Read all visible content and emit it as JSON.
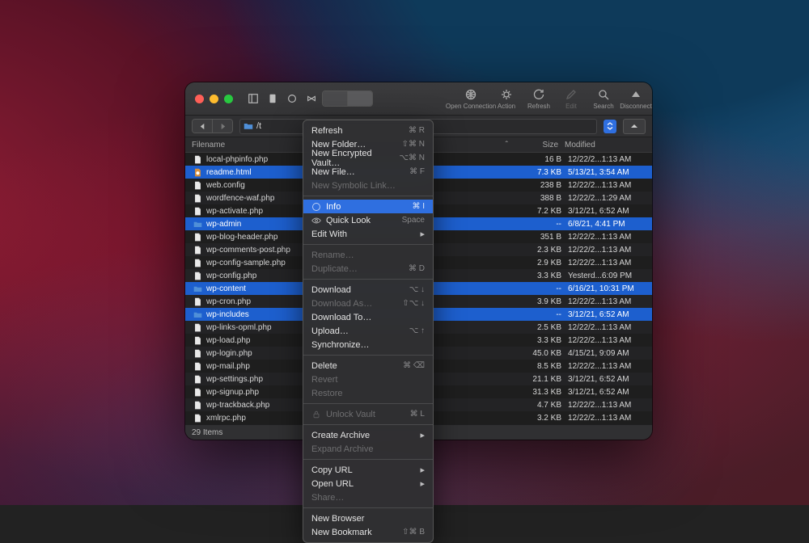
{
  "toolbar": {
    "buttons": [
      {
        "id": "open-connection",
        "label": "Open Connection"
      },
      {
        "id": "action",
        "label": "Action"
      },
      {
        "id": "refresh",
        "label": "Refresh"
      },
      {
        "id": "edit",
        "label": "Edit",
        "disabled": true
      },
      {
        "id": "search",
        "label": "Search"
      },
      {
        "id": "disconnect",
        "label": "Disconnect"
      }
    ]
  },
  "path": "/t",
  "columns": {
    "name": "Filename",
    "size": "Size",
    "modified": "Modified"
  },
  "files": [
    {
      "name": "local-phpinfo.php",
      "icon": "file",
      "size": "16 B",
      "mod": "12/22/2...1:13 AM"
    },
    {
      "name": "readme.html",
      "icon": "html",
      "size": "7.3 KB",
      "mod": "5/13/21, 3:54 AM",
      "selected": true
    },
    {
      "name": "web.config",
      "icon": "file",
      "size": "238 B",
      "mod": "12/22/2...1:13 AM"
    },
    {
      "name": "wordfence-waf.php",
      "icon": "file",
      "size": "388 B",
      "mod": "12/22/2...1:29 AM"
    },
    {
      "name": "wp-activate.php",
      "icon": "file",
      "size": "7.2 KB",
      "mod": "3/12/21, 6:52 AM"
    },
    {
      "name": "wp-admin",
      "icon": "folder",
      "size": "--",
      "mod": "6/8/21, 4:41 PM",
      "selected": true
    },
    {
      "name": "wp-blog-header.php",
      "icon": "file",
      "size": "351 B",
      "mod": "12/22/2...1:13 AM"
    },
    {
      "name": "wp-comments-post.php",
      "icon": "file",
      "size": "2.3 KB",
      "mod": "12/22/2...1:13 AM"
    },
    {
      "name": "wp-config-sample.php",
      "icon": "file",
      "size": "2.9 KB",
      "mod": "12/22/2...1:13 AM"
    },
    {
      "name": "wp-config.php",
      "icon": "file",
      "size": "3.3 KB",
      "mod": "Yesterd...6:09 PM"
    },
    {
      "name": "wp-content",
      "icon": "folder",
      "size": "--",
      "mod": "6/16/21, 10:31 PM",
      "selected": true
    },
    {
      "name": "wp-cron.php",
      "icon": "file",
      "size": "3.9 KB",
      "mod": "12/22/2...1:13 AM"
    },
    {
      "name": "wp-includes",
      "icon": "folder",
      "size": "--",
      "mod": "3/12/21, 6:52 AM",
      "selected": true
    },
    {
      "name": "wp-links-opml.php",
      "icon": "file",
      "size": "2.5 KB",
      "mod": "12/22/2...1:13 AM"
    },
    {
      "name": "wp-load.php",
      "icon": "file",
      "size": "3.3 KB",
      "mod": "12/22/2...1:13 AM"
    },
    {
      "name": "wp-login.php",
      "icon": "file",
      "size": "45.0 KB",
      "mod": "4/15/21, 9:09 AM"
    },
    {
      "name": "wp-mail.php",
      "icon": "file",
      "size": "8.5 KB",
      "mod": "12/22/2...1:13 AM"
    },
    {
      "name": "wp-settings.php",
      "icon": "file",
      "size": "21.1 KB",
      "mod": "3/12/21, 6:52 AM"
    },
    {
      "name": "wp-signup.php",
      "icon": "file",
      "size": "31.3 KB",
      "mod": "3/12/21, 6:52 AM"
    },
    {
      "name": "wp-trackback.php",
      "icon": "file",
      "size": "4.7 KB",
      "mod": "12/22/2...1:13 AM"
    },
    {
      "name": "xmlrpc.php",
      "icon": "file",
      "size": "3.2 KB",
      "mod": "12/22/2...1:13 AM"
    }
  ],
  "footer": "29 Items",
  "menu": [
    {
      "label": "Refresh",
      "short": "⌘ R"
    },
    {
      "label": "New Folder…",
      "short": "⇧⌘ N"
    },
    {
      "label": "New Encrypted Vault…",
      "short": "⌥⌘ N"
    },
    {
      "label": "New File…",
      "short": "⌘ F"
    },
    {
      "label": "New Symbolic Link…",
      "disabled": true
    },
    {
      "sep": true
    },
    {
      "label": "Info",
      "short": "⌘ I",
      "selected": true,
      "icon": "info"
    },
    {
      "label": "Quick Look",
      "short": "Space",
      "icon": "eye"
    },
    {
      "label": "Edit With",
      "arrow": true
    },
    {
      "sep": true
    },
    {
      "label": "Rename…",
      "disabled": true
    },
    {
      "label": "Duplicate…",
      "short": "⌘ D",
      "disabled": true
    },
    {
      "sep": true
    },
    {
      "label": "Download",
      "short": "⌥ ↓"
    },
    {
      "label": "Download As…",
      "short": "⇧⌥ ↓",
      "disabled": true
    },
    {
      "label": "Download To…"
    },
    {
      "label": "Upload…",
      "short": "⌥ ↑"
    },
    {
      "label": "Synchronize…"
    },
    {
      "sep": true
    },
    {
      "label": "Delete",
      "short": "⌘ ⌫"
    },
    {
      "label": "Revert",
      "disabled": true
    },
    {
      "label": "Restore",
      "disabled": true
    },
    {
      "sep": true
    },
    {
      "label": "Unlock Vault",
      "short": "⌘ L",
      "disabled": true,
      "icon": "lock"
    },
    {
      "sep": true
    },
    {
      "label": "Create Archive",
      "arrow": true
    },
    {
      "label": "Expand Archive",
      "disabled": true
    },
    {
      "sep": true
    },
    {
      "label": "Copy URL",
      "arrow": true
    },
    {
      "label": "Open URL",
      "arrow": true
    },
    {
      "label": "Share…",
      "disabled": true
    },
    {
      "sep": true
    },
    {
      "label": "New Browser"
    },
    {
      "label": "New Bookmark",
      "short": "⇧⌘ B"
    }
  ]
}
